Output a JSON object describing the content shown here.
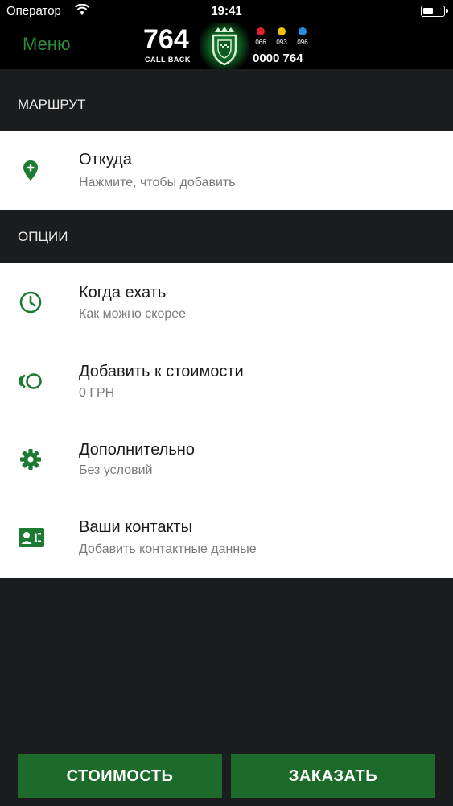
{
  "status_bar": {
    "carrier": "Оператор",
    "time": "19:41"
  },
  "nav": {
    "menu_label": "Меню",
    "logo": {
      "number": "764",
      "callback": "CALL BACK",
      "operators": [
        {
          "code": "066",
          "color": "#e0202a"
        },
        {
          "code": "093",
          "color": "#f2c300"
        },
        {
          "code": "096",
          "color": "#2a8be0"
        }
      ],
      "phone": "0000 764"
    }
  },
  "route": {
    "header": "МАРШРУТ",
    "from": {
      "title": "Откуда",
      "subtitle": "Нажмите, чтобы добавить",
      "icon": "map-pin-add-icon"
    }
  },
  "options": {
    "header": "ОПЦИИ",
    "items": [
      {
        "title": "Когда ехать",
        "subtitle": "Как можно скорее",
        "icon": "clock-icon"
      },
      {
        "title": "Добавить к стоимости",
        "subtitle": "0 ГРН",
        "icon": "coins-icon"
      },
      {
        "title": "Дополнительно",
        "subtitle": "Без условий",
        "icon": "gear-icon"
      },
      {
        "title": "Ваши контакты",
        "subtitle": "Добавить контактные данные",
        "icon": "contact-card-icon"
      }
    ]
  },
  "actions": {
    "cost_label": "СТОИМОСТЬ",
    "order_label": "ЗАКАЗАТЬ"
  },
  "colors": {
    "accent": "#2e8b3a",
    "button": "#1d6b2a",
    "background": "#1b1c1d"
  }
}
